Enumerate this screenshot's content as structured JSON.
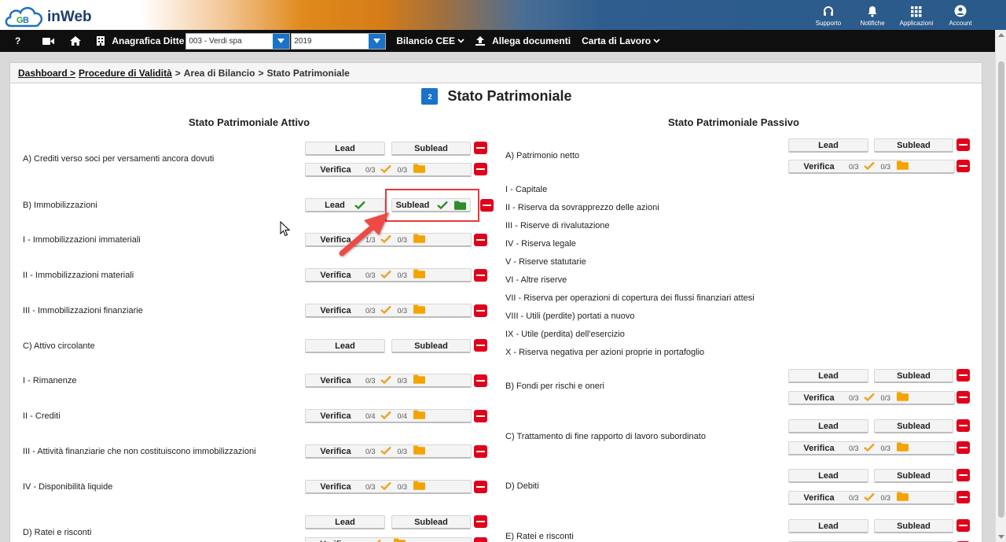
{
  "app": {
    "logo_text": "inWeb"
  },
  "topnav": [
    {
      "label": "Supporto",
      "icon": "headset-icon"
    },
    {
      "label": "Notifiche",
      "icon": "bell-icon"
    },
    {
      "label": "Applicazioni",
      "icon": "grid-icon"
    },
    {
      "label": "Account",
      "icon": "user-icon"
    }
  ],
  "menubar": {
    "help": "?",
    "anagrafica_label": "Anagrafica Ditte",
    "ditta_value": "003 - Verdi spa",
    "year_value": "2019",
    "bilancio_label": "Bilancio CEE",
    "allega_label": "Allega documenti",
    "carta_label": "Carta di Lavoro"
  },
  "breadcrumb": {
    "item1": "Dashboard",
    "item2": "Procedure di Validità",
    "item3": "Area di Bilancio",
    "item4": "Stato Patrimoniale",
    "sep": ">"
  },
  "page": {
    "badge": "2",
    "title": "Stato Patrimoniale"
  },
  "labels": {
    "lead": "Lead",
    "sublead": "Sublead",
    "verifica": "Verifica"
  },
  "attivo": {
    "heading": "Stato Patrimoniale Attivo",
    "rows": [
      {
        "label": "A) Crediti verso soci per versamenti ancora dovuti",
        "c1": "0/3",
        "c2": "0/3"
      },
      {
        "label": "B) Immobilizzazioni"
      },
      {
        "label": "I - Immobilizzazioni immateriali",
        "c1": "1/3",
        "c2": "0/3"
      },
      {
        "label": "II - Immobilizzazioni materiali",
        "c1": "0/3",
        "c2": "0/3"
      },
      {
        "label": "III - Immobilizzazioni finanziarie",
        "c1": "0/3",
        "c2": "0/3"
      },
      {
        "label": "C) Attivo circolante"
      },
      {
        "label": "I - Rimanenze",
        "c1": "0/3",
        "c2": "0/3"
      },
      {
        "label": "II - Crediti",
        "c1": "0/4",
        "c2": "0/4"
      },
      {
        "label": "III - Attività finanziarie che non costituiscono immobilizzazioni",
        "c1": "0/3",
        "c2": "0/3"
      },
      {
        "label": "IV - Disponibilità liquide",
        "c1": "0/3",
        "c2": "0/3"
      },
      {
        "label": "D) Ratei e risconti"
      }
    ]
  },
  "passivo": {
    "heading": "Stato Patrimoniale Passivo",
    "rows": [
      {
        "label": "A) Patrimonio netto",
        "c1": "0/3",
        "c2": "0/3"
      },
      {
        "label": "I - Capitale"
      },
      {
        "label": "II - Riserva da sovrapprezzo delle azioni"
      },
      {
        "label": "III - Riserve di rivalutazione"
      },
      {
        "label": "IV - Riserva legale"
      },
      {
        "label": "V - Riserve statutarie"
      },
      {
        "label": "VI - Altre riserve"
      },
      {
        "label": "VII - Riserva per operazioni di copertura dei flussi finanziari attesi"
      },
      {
        "label": "VIII - Utili (perdite) portati a nuovo"
      },
      {
        "label": "IX - Utile (perdita) dell'esercizio"
      },
      {
        "label": "X - Riserva negativa per azioni proprie in portafoglio"
      },
      {
        "label": "B) Fondi per rischi e oneri",
        "c1": "0/3",
        "c2": "0/3"
      },
      {
        "label": "C) Trattamento di fine rapporto di lavoro subordinato",
        "c1": "0/3",
        "c2": "0/3"
      },
      {
        "label": "D) Debiti",
        "c1": "0/3",
        "c2": "0/3"
      },
      {
        "label": "E) Ratei e risconti"
      }
    ]
  },
  "colors": {
    "accent": "#1a73c9",
    "danger": "#e0001b",
    "check_orange": "#f0a020",
    "folder_orange": "#f5a300",
    "done_green": "#2e8b2e",
    "highlight": "#e8383d"
  }
}
